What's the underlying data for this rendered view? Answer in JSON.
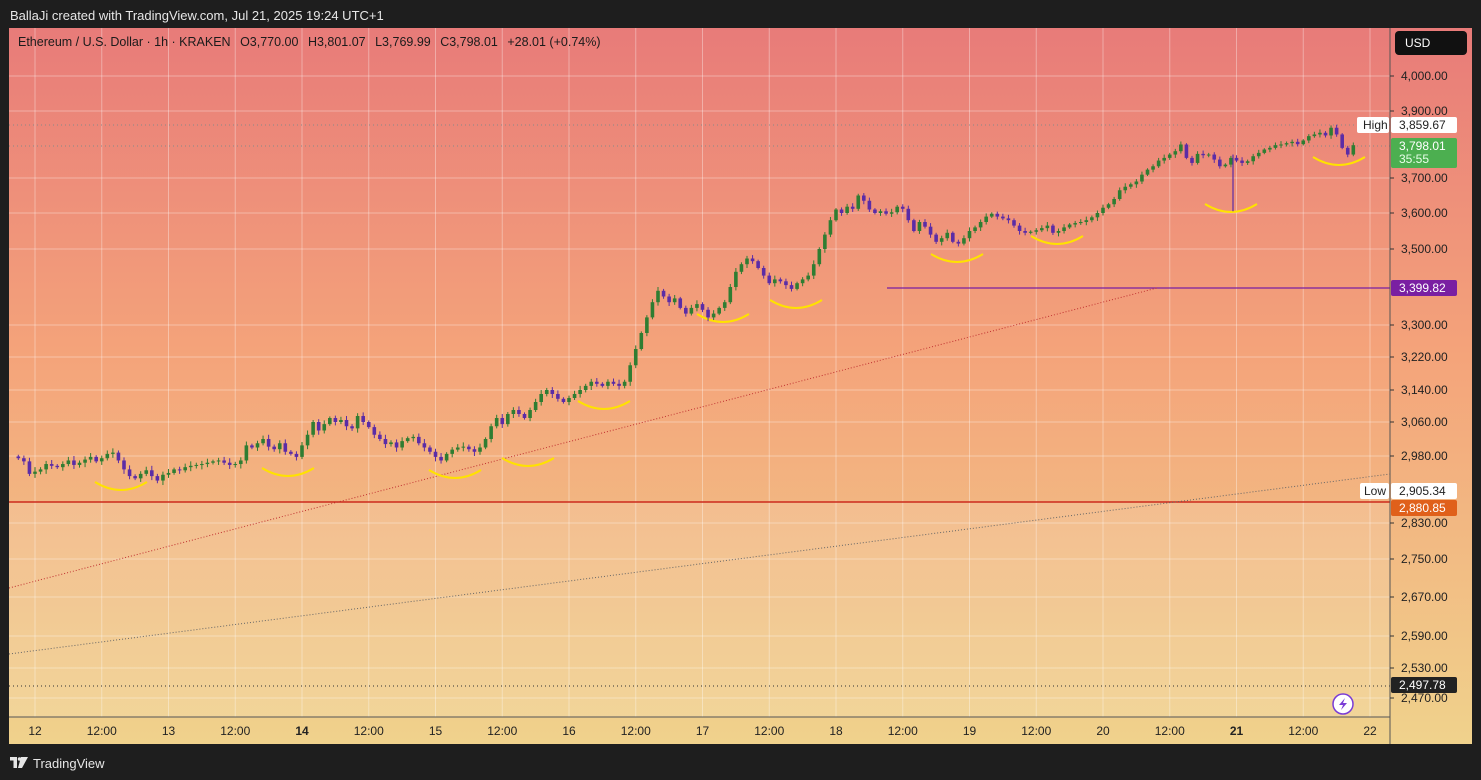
{
  "header": {
    "attribution": "BallaJi created with TradingView.com, Jul 21, 2025 19:24 UTC+1"
  },
  "legend": {
    "symbol": "Ethereum / U.S. Dollar · 1h · KRAKEN",
    "open": "O3,770.00",
    "high": "H3,801.07",
    "low": "L3,769.99",
    "close": "C3,798.01",
    "change": "+28.01 (+0.74%)"
  },
  "currency_button": "USD",
  "footer": {
    "brand": "TradingView"
  },
  "colors": {
    "bg_top": "#e87b79",
    "bg_mid": "#f4a37a",
    "bg_bottom": "#f0d28c",
    "bull": "#2f7d32",
    "bear": "#5b2ca6",
    "support": "#cc2a1c",
    "resistance": "#7a1fa2",
    "current": "#4caf50",
    "arc": "#ffe200"
  },
  "chart_data": {
    "type": "candlestick",
    "title": "Ethereum / U.S. Dollar · 1h · KRAKEN",
    "interval": "1h",
    "x_tick_labels": [
      "12",
      "12:00",
      "13",
      "12:00",
      "14",
      "12:00",
      "15",
      "12:00",
      "16",
      "12:00",
      "17",
      "12:00",
      "18",
      "12:00",
      "19",
      "12:00",
      "20",
      "12:00",
      "21",
      "12:00",
      "22"
    ],
    "bold_x_ticks": [
      "14",
      "21"
    ],
    "y_tick_labels": [
      "4,000.00",
      "3,900.00",
      "3,700.00",
      "3,600.00",
      "3,500.00",
      "3,300.00",
      "3,220.00",
      "3,140.00",
      "3,060.00",
      "2,980.00",
      "2,830.00",
      "2,750.00",
      "2,670.00",
      "2,590.00",
      "2,530.00",
      "2,470.00"
    ],
    "y_range": [
      2450,
      4070
    ],
    "x_range": [
      "2025-07-11T21:00",
      "2025-07-22T02:00"
    ],
    "closes": [
      2975,
      2968,
      2940,
      2945,
      2950,
      2962,
      2958,
      2955,
      2962,
      2970,
      2960,
      2965,
      2972,
      2978,
      2968,
      2975,
      2985,
      2988,
      2970,
      2950,
      2935,
      2930,
      2940,
      2948,
      2935,
      2925,
      2938,
      2942,
      2950,
      2948,
      2955,
      2958,
      2960,
      2962,
      2965,
      2968,
      2970,
      2965,
      2960,
      2962,
      2970,
      3005,
      3000,
      3010,
      3020,
      3002,
      2996,
      3010,
      2990,
      2985,
      2978,
      3005,
      3030,
      3060,
      3040,
      3055,
      3070,
      3060,
      3065,
      3050,
      3045,
      3075,
      3060,
      3048,
      3030,
      3020,
      3008,
      3012,
      3000,
      3015,
      3022,
      3025,
      3010,
      3000,
      2990,
      2978,
      2970,
      2985,
      2995,
      3000,
      3002,
      2996,
      2990,
      3000,
      3020,
      3050,
      3070,
      3055,
      3080,
      3090,
      3080,
      3070,
      3090,
      3110,
      3130,
      3140,
      3130,
      3118,
      3110,
      3120,
      3130,
      3140,
      3150,
      3160,
      3155,
      3150,
      3160,
      3155,
      3150,
      3160,
      3200,
      3240,
      3280,
      3320,
      3360,
      3390,
      3375,
      3360,
      3370,
      3345,
      3330,
      3345,
      3355,
      3340,
      3320,
      3330,
      3345,
      3360,
      3400,
      3440,
      3460,
      3475,
      3468,
      3450,
      3430,
      3410,
      3420,
      3415,
      3405,
      3395,
      3410,
      3420,
      3430,
      3460,
      3500,
      3540,
      3580,
      3610,
      3600,
      3618,
      3612,
      3650,
      3635,
      3610,
      3600,
      3605,
      3598,
      3602,
      3618,
      3612,
      3580,
      3550,
      3575,
      3562,
      3540,
      3520,
      3530,
      3545,
      3520,
      3515,
      3530,
      3550,
      3560,
      3575,
      3590,
      3598,
      3590,
      3585,
      3580,
      3565,
      3550,
      3545,
      3548,
      3552,
      3558,
      3565,
      3545,
      3550,
      3560,
      3568,
      3572,
      3575,
      3580,
      3588,
      3600,
      3615,
      3625,
      3640,
      3665,
      3675,
      3682,
      3690,
      3710,
      3725,
      3735,
      3752,
      3760,
      3770,
      3780,
      3800,
      3760,
      3745,
      3772,
      3768,
      3770,
      3755,
      3735,
      3740,
      3760,
      3752,
      3745,
      3750,
      3765,
      3775,
      3785,
      3790,
      3798,
      3800,
      3804,
      3808,
      3801,
      3812,
      3825,
      3830,
      3835,
      3827,
      3850,
      3830,
      3790,
      3770,
      3798
    ]
  }
}
